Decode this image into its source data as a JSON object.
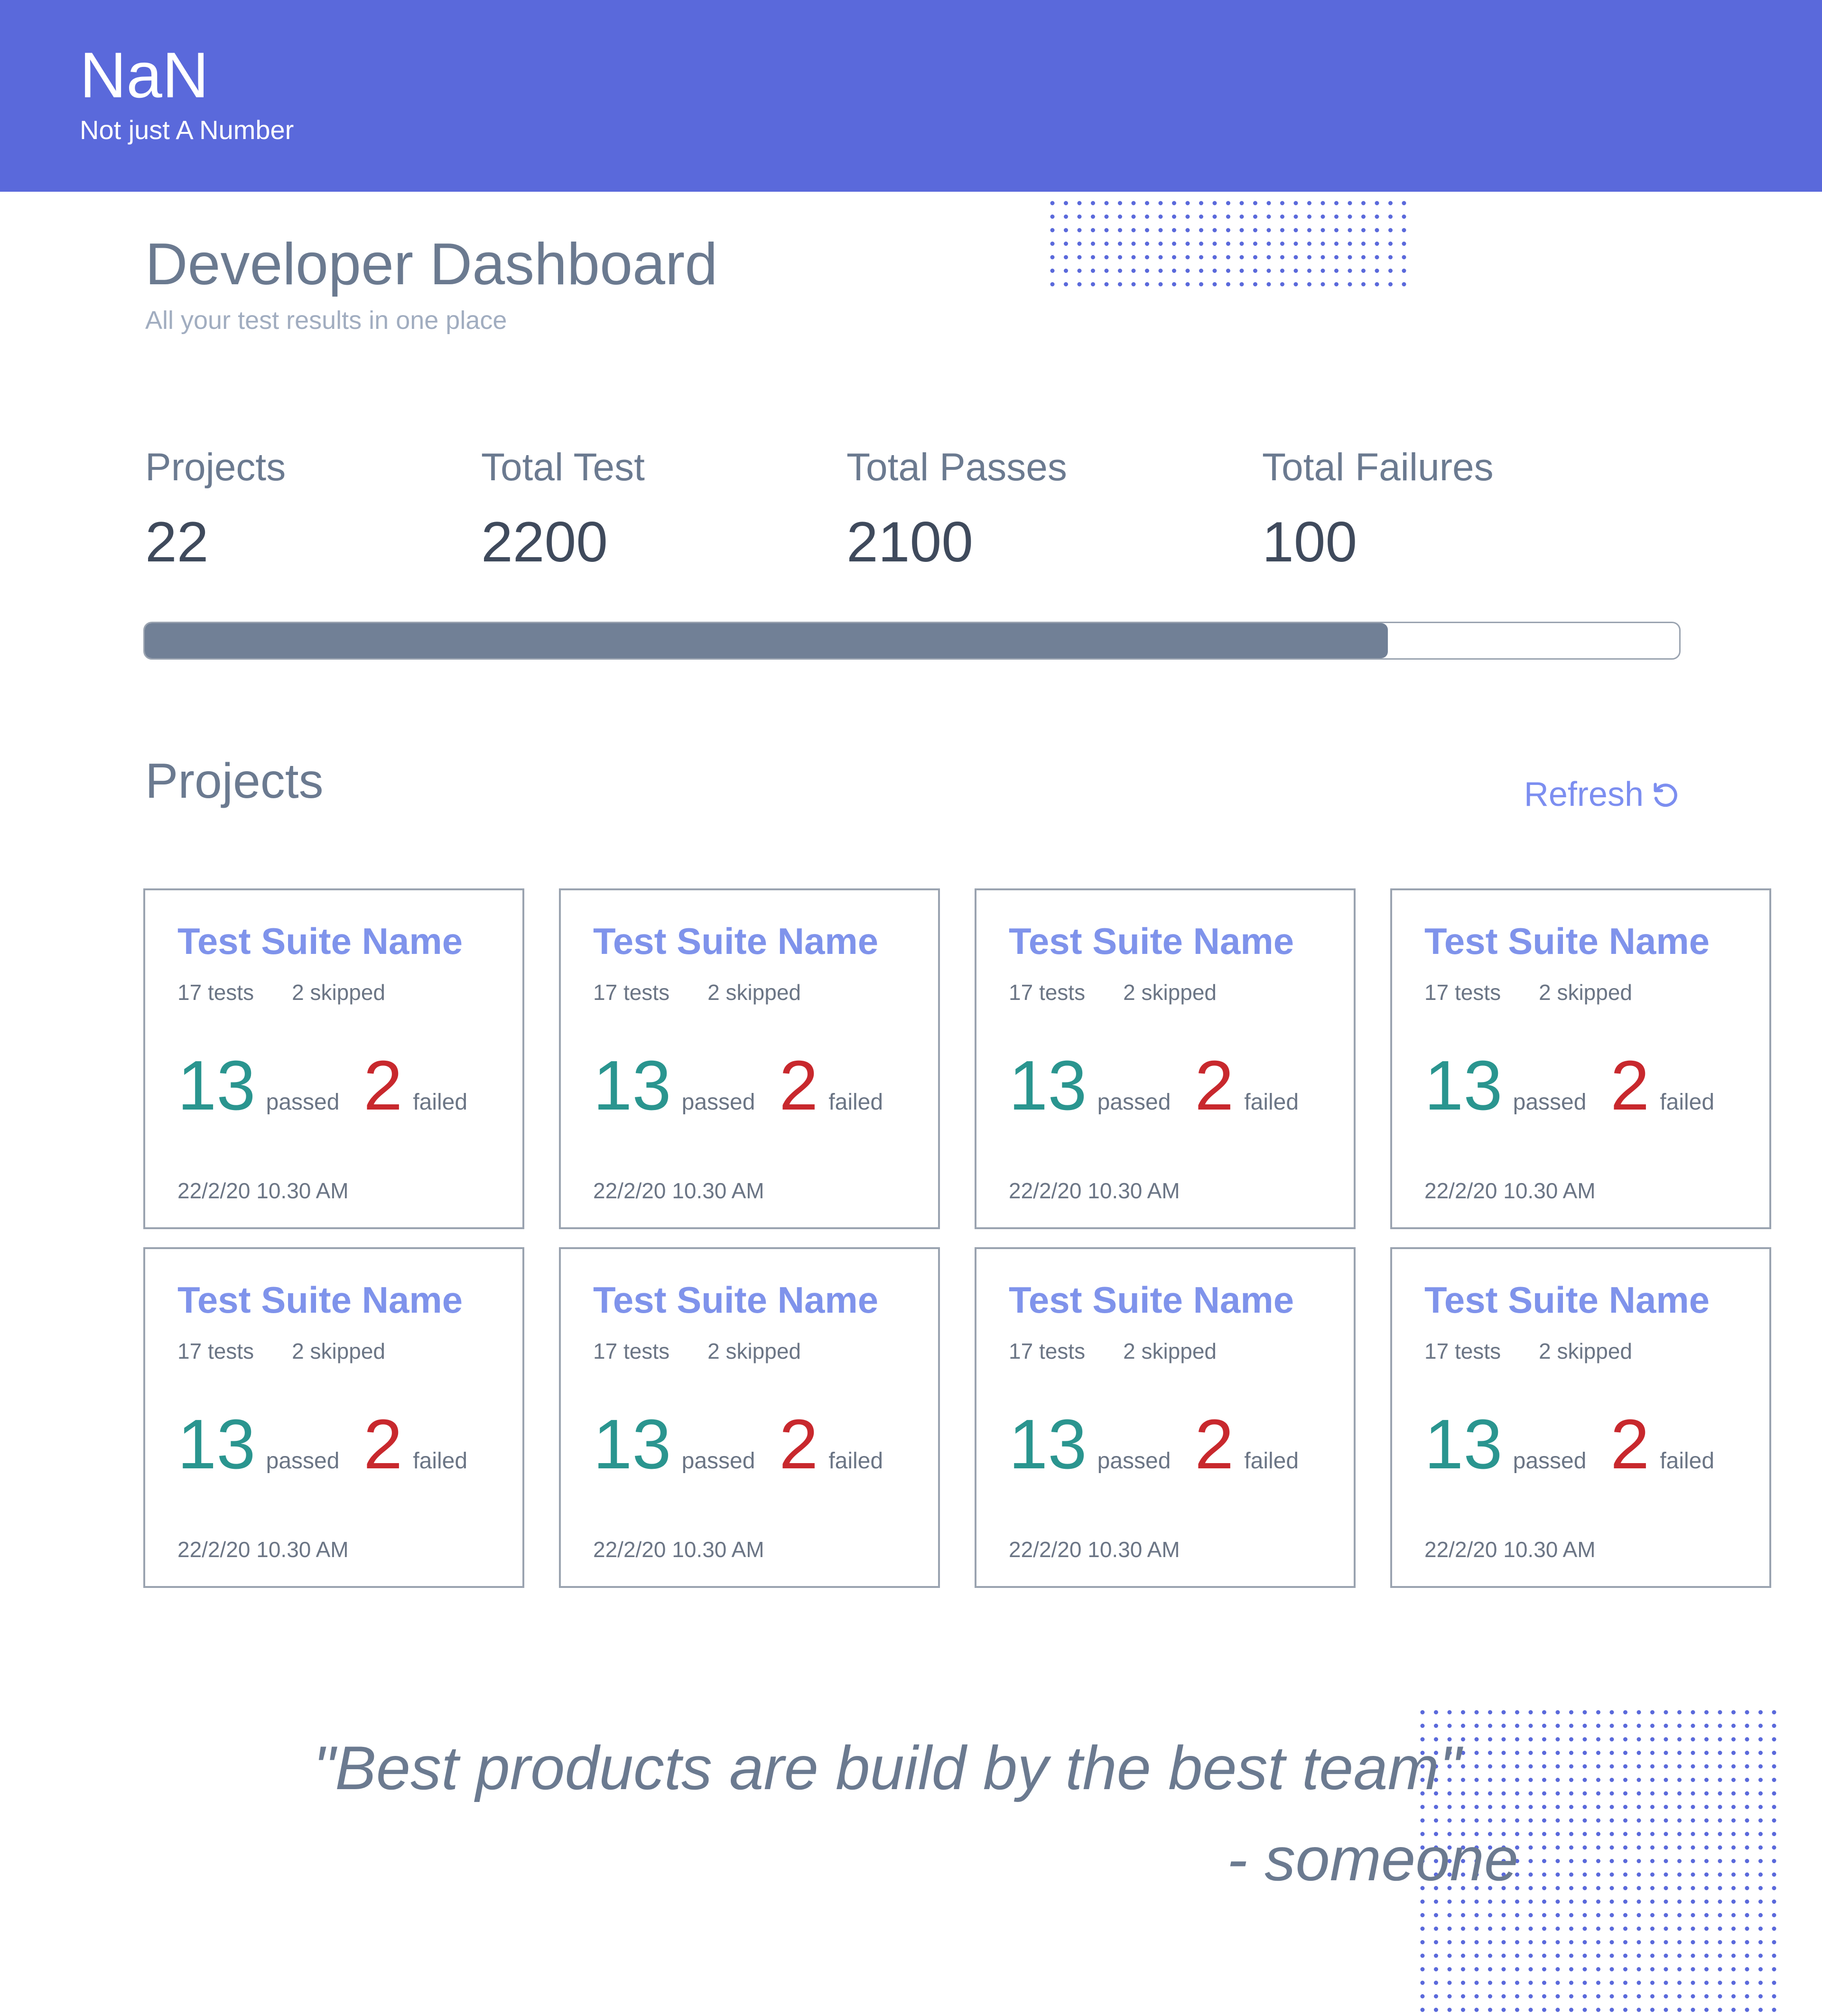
{
  "header": {
    "title": "NaN",
    "subtitle": "Not just A Number",
    "background": "#5a69db"
  },
  "page": {
    "title": "Developer Dashboard",
    "subtitle": "All your test results in one place"
  },
  "stats": {
    "projects": {
      "label": "Projects",
      "value": "22"
    },
    "total_test": {
      "label": "Total Test",
      "value": "2200"
    },
    "total_passes": {
      "label": "Total Passes",
      "value": "2100"
    },
    "total_failures": {
      "label": "Total Failures",
      "value": "100"
    }
  },
  "progress": {
    "fraction": 0.81,
    "fill_color": "#718096"
  },
  "projects_section": {
    "title": "Projects",
    "refresh_label": "Refresh",
    "refresh_icon": "refresh-icon"
  },
  "cards": [
    {
      "title": "Test Suite Name",
      "tests": "17 tests",
      "skipped": "2 skipped",
      "passed": "13",
      "passed_label": "passed",
      "failed": "2",
      "failed_label": "failed",
      "time": "22/2/20 10.30 AM"
    },
    {
      "title": "Test Suite Name",
      "tests": "17 tests",
      "skipped": "2 skipped",
      "passed": "13",
      "passed_label": "passed",
      "failed": "2",
      "failed_label": "failed",
      "time": "22/2/20 10.30 AM"
    },
    {
      "title": "Test Suite Name",
      "tests": "17 tests",
      "skipped": "2 skipped",
      "passed": "13",
      "passed_label": "passed",
      "failed": "2",
      "failed_label": "failed",
      "time": "22/2/20 10.30 AM"
    },
    {
      "title": "Test Suite Name",
      "tests": "17 tests",
      "skipped": "2 skipped",
      "passed": "13",
      "passed_label": "passed",
      "failed": "2",
      "failed_label": "failed",
      "time": "22/2/20 10.30 AM"
    },
    {
      "title": "Test Suite Name",
      "tests": "17 tests",
      "skipped": "2 skipped",
      "passed": "13",
      "passed_label": "passed",
      "failed": "2",
      "failed_label": "failed",
      "time": "22/2/20 10.30 AM"
    },
    {
      "title": "Test Suite Name",
      "tests": "17 tests",
      "skipped": "2 skipped",
      "passed": "13",
      "passed_label": "passed",
      "failed": "2",
      "failed_label": "failed",
      "time": "22/2/20 10.30 AM"
    },
    {
      "title": "Test Suite Name",
      "tests": "17 tests",
      "skipped": "2 skipped",
      "passed": "13",
      "passed_label": "passed",
      "failed": "2",
      "failed_label": "failed",
      "time": "22/2/20 10.30 AM"
    },
    {
      "title": "Test Suite Name",
      "tests": "17 tests",
      "skipped": "2 skipped",
      "passed": "13",
      "passed_label": "passed",
      "failed": "2",
      "failed_label": "failed",
      "time": "22/2/20 10.30 AM"
    }
  ],
  "quote": {
    "text": "\"Best products are build by the best team\"",
    "author": "- someone"
  },
  "colors": {
    "accent": "#7f93eb",
    "passed": "#2a958f",
    "failed": "#c8282d",
    "dot_pattern": "#5a69db"
  }
}
